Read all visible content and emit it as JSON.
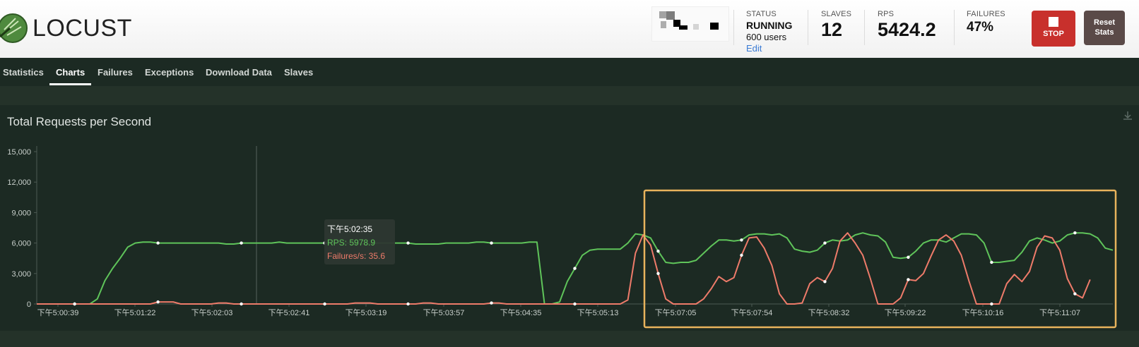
{
  "app": {
    "name": "LOCUST"
  },
  "header": {
    "status_label": "STATUS",
    "status_value": "RUNNING",
    "users_text": "600 users",
    "edit_label": "Edit",
    "slaves_label": "SLAVES",
    "slaves_value": "12",
    "rps_label": "RPS",
    "rps_value": "5424.2",
    "failures_label": "FAILURES",
    "failures_value": "47%",
    "stop_label": "STOP",
    "reset_label_1": "Reset",
    "reset_label_2": "Stats"
  },
  "tabs": [
    {
      "label": "Statistics"
    },
    {
      "label": "Charts",
      "active": true
    },
    {
      "label": "Failures"
    },
    {
      "label": "Exceptions"
    },
    {
      "label": "Download Data"
    },
    {
      "label": "Slaves"
    }
  ],
  "icons": {
    "logo": "locust-logo-icon",
    "stop": "stop-square-icon",
    "download": "download-icon"
  },
  "colors": {
    "rps": "#5fc45a",
    "failures": "#ee7b6a",
    "highlight_box": "#e8b35c",
    "stop_button": "#c8302c",
    "reset_button": "#5a4a48"
  },
  "tooltip": {
    "time": "下午5:02:35",
    "rps": "RPS: 5978.9",
    "failures": "Failures/s: 35.6"
  },
  "chart_data": {
    "type": "line",
    "title": "Total Requests per Second",
    "ylim": [
      0,
      15000
    ],
    "yticks": [
      "15,000",
      "12,000",
      "9,000",
      "6,000",
      "3,000",
      "0"
    ],
    "xticks": [
      "下午5:00:39",
      "下午5:01:22",
      "下午5:02:03",
      "下午5:02:41",
      "下午5:03:19",
      "下午5:03:57",
      "下午5:04:35",
      "下午5:05:13",
      "下午5:07:05",
      "下午5:07:54",
      "下午5:08:32",
      "下午5:09:22",
      "下午5:10:16",
      "下午5:11:07"
    ],
    "grid": false,
    "series": [
      {
        "name": "RPS",
        "values": [
          0,
          0,
          0,
          0,
          0,
          0,
          0,
          0,
          500,
          2300,
          3500,
          4500,
          5600,
          6000,
          6100,
          6100,
          6000,
          6000,
          6000,
          6000,
          6000,
          6000,
          6000,
          6000,
          6000,
          5900,
          5900,
          6000,
          6000,
          6000,
          6000,
          6000,
          6100,
          6000,
          6000,
          6000,
          6000,
          6000,
          6000,
          6000,
          6000,
          6000,
          5900,
          5900,
          5900,
          6000,
          6000,
          6000,
          6000,
          6000,
          5900,
          5900,
          5900,
          5900,
          6000,
          6000,
          6000,
          6000,
          6100,
          6100,
          6000,
          6000,
          6000,
          6000,
          6000,
          6100,
          6100,
          0,
          0,
          200,
          2200,
          3500,
          4800,
          5300,
          5400,
          5400,
          5400,
          5400,
          6000,
          6900,
          6800,
          6500,
          5200,
          4100,
          4000,
          4100,
          4100,
          4300,
          5000,
          5700,
          6300,
          6300,
          6200,
          6300,
          6800,
          6900,
          6900,
          6800,
          6900,
          6500,
          5400,
          5200,
          5100,
          5300,
          6000,
          6300,
          6200,
          6300,
          6800,
          7000,
          6800,
          6700,
          6100,
          4600,
          4500,
          4600,
          5200,
          6000,
          6300,
          6300,
          6100,
          6500,
          6900,
          6900,
          6800,
          6000,
          4100,
          4100,
          4200,
          4300,
          5100,
          6200,
          6500,
          6300,
          6000,
          6200,
          6800,
          7000,
          7000,
          6900,
          6500,
          5500,
          5300
        ]
      },
      {
        "name": "Failures/s",
        "values": [
          0,
          0,
          0,
          0,
          0,
          0,
          0,
          0,
          0,
          0,
          0,
          0,
          0,
          0,
          0,
          0,
          200,
          200,
          200,
          0,
          0,
          0,
          0,
          0,
          100,
          100,
          0,
          0,
          0,
          0,
          0,
          0,
          0,
          0,
          0,
          0,
          0,
          0,
          0,
          0,
          0,
          0,
          100,
          100,
          100,
          0,
          0,
          0,
          0,
          0,
          0,
          100,
          100,
          0,
          0,
          0,
          0,
          0,
          0,
          0,
          100,
          100,
          0,
          0,
          0,
          0,
          0,
          0,
          0,
          0,
          0,
          0,
          0,
          0,
          0,
          0,
          0,
          0,
          400,
          5000,
          6800,
          5800,
          3000,
          500,
          0,
          0,
          0,
          0,
          500,
          1500,
          2700,
          2200,
          2600,
          4800,
          6500,
          6600,
          5500,
          3800,
          1000,
          0,
          0,
          100,
          2000,
          2600,
          2200,
          3500,
          6200,
          7000,
          6000,
          4800,
          2500,
          0,
          0,
          0,
          600,
          2400,
          2300,
          3000,
          4700,
          6300,
          6800,
          6200,
          4800,
          2300,
          0,
          0,
          0,
          0,
          2000,
          2900,
          2200,
          3200,
          5600,
          6700,
          6500,
          5300,
          2500,
          1000,
          600,
          2400
        ]
      }
    ]
  }
}
